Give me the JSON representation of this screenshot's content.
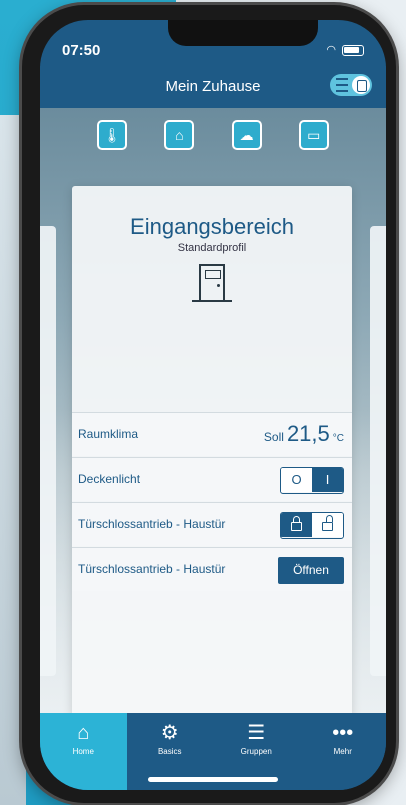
{
  "status": {
    "time": "07:50"
  },
  "header": {
    "title": "Mein Zuhause"
  },
  "categories": [
    {
      "icon": "thermometer-icon",
      "glyph": "🌡"
    },
    {
      "icon": "house-info-icon",
      "glyph": "⌂"
    },
    {
      "icon": "cloud-icon",
      "glyph": "☁"
    },
    {
      "icon": "window-icon",
      "glyph": "▭"
    }
  ],
  "card": {
    "title": "Eingangsbereich",
    "subtitle": "Standardprofil",
    "rows": [
      {
        "label": "Raumklima",
        "soll_label": "Soll",
        "soll_value": "21,5",
        "soll_unit": "°C"
      },
      {
        "label": "Deckenlicht",
        "off": "O",
        "on": "I"
      },
      {
        "label": "Türschlossantrieb - Haustür"
      },
      {
        "label": "Türschlossantrieb - Haustür",
        "button": "Öffnen"
      }
    ]
  },
  "tabs": [
    {
      "label": "Home",
      "glyph": "⌂"
    },
    {
      "label": "Basics",
      "glyph": "⚙"
    },
    {
      "label": "Gruppen",
      "glyph": "☰"
    },
    {
      "label": "Mehr",
      "glyph": "•••"
    }
  ],
  "colors": {
    "primary": "#1e5a86",
    "accent": "#2cb3d6",
    "background": "#2aaed0"
  }
}
